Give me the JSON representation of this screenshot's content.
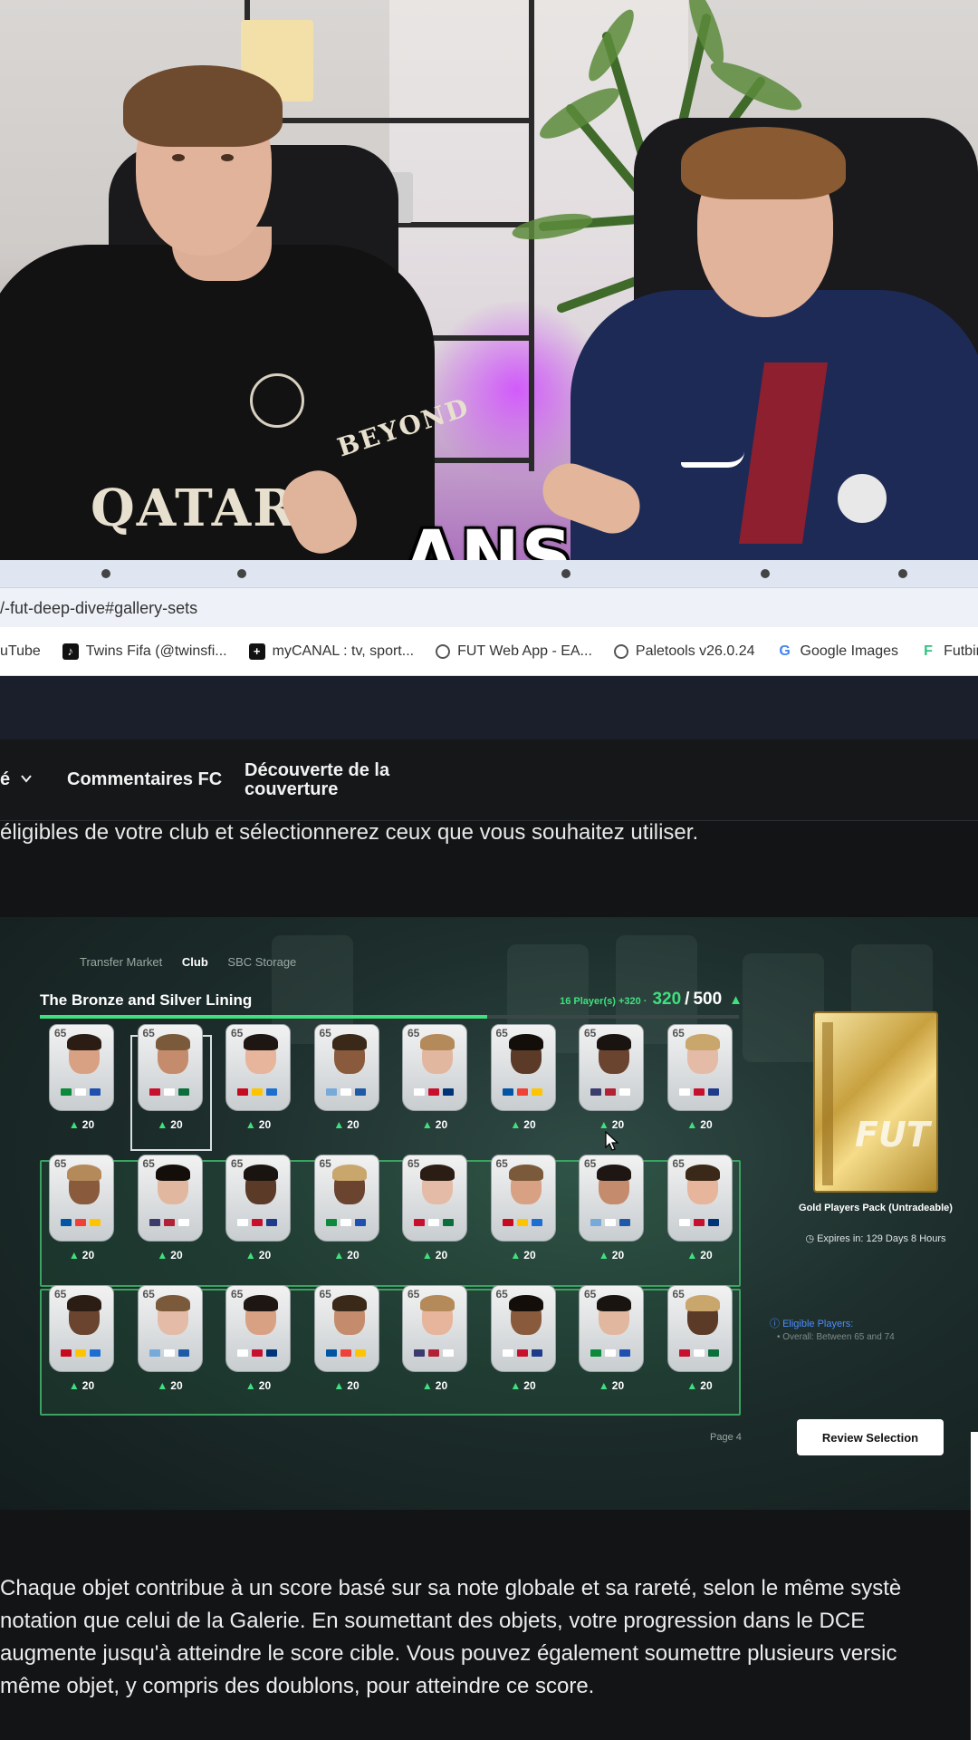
{
  "video": {
    "caption": "ANS"
  },
  "browser": {
    "url": "/-fut-deep-dive#gallery-sets",
    "bookmarks": [
      {
        "label": "uTube",
        "icon": "youtube-icon"
      },
      {
        "label": "Twins Fifa (@twinsfi...",
        "icon": "tiktok-icon"
      },
      {
        "label": "myCANAL : tv, sport...",
        "icon": "canal-icon"
      },
      {
        "label": "FUT Web App - EA...",
        "icon": "globe-icon"
      },
      {
        "label": "Paletools v26.0.24",
        "icon": "globe-icon"
      },
      {
        "label": "Google Images",
        "icon": "google-icon"
      },
      {
        "label": "Futbin",
        "icon": "futbin-icon"
      }
    ]
  },
  "nav": {
    "item_partial": "é",
    "item_feedback": "Commentaires FC",
    "item_discovery": "Découverte de la couverture"
  },
  "intro_text": "éligibles de votre club et sélectionnerez ceux que vous souhaitez utiliser.",
  "sbc": {
    "tabs": [
      "Transfer Market",
      "Club",
      "SBC Storage"
    ],
    "active_tab": "Club",
    "title": "The Bronze and Silver Lining",
    "score_detail": "16 Player(s) +320 ·",
    "score_current": "320",
    "score_separator": "/",
    "score_target": "500",
    "progress": 0.64,
    "card_overall": "65",
    "card_value": "20",
    "pack_name": "Gold Players Pack (Untradeable)",
    "pack_expires": "Expires in: 129 Days 8 Hours",
    "pack_label": "FUT",
    "eligible_title": "Eligible Players:",
    "eligible_rule": "• Overall: Between 65 and 74",
    "page": "Page 4",
    "review_button": "Review Selection"
  },
  "body_paragraph": [
    "Chaque objet contribue à un score basé sur sa note globale et sa rareté, selon le même systè",
    "notation que celui de la Galerie. En soumettant des objets, votre progression dans le DCE",
    "augmente jusqu'à atteindre le score cible. Vous pouvez également soumettre plusieurs versic",
    "même objet, y compris des doublons, pour atteindre ce score."
  ],
  "colors": {
    "accent_green": "#3fe07e",
    "page_bg": "#121416",
    "review_button_bg": "#ffffff"
  }
}
